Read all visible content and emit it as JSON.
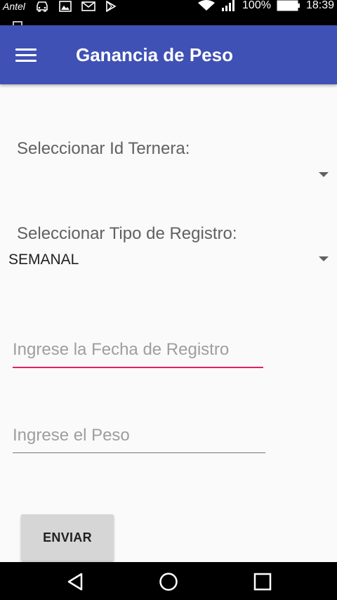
{
  "status_bar": {
    "carrier": "Antel",
    "battery": "100%",
    "time": "18:39",
    "icons": [
      "car-icon",
      "image-icon",
      "mail-icon",
      "play-store-icon",
      "wifi-icon",
      "signal-icon",
      "battery-icon"
    ]
  },
  "toolbar": {
    "title": "Ganancia de Peso",
    "menu_icon": "hamburger-menu-icon",
    "background": "#3f51b5"
  },
  "form": {
    "ternera_label": "Seleccionar Id Ternera:",
    "ternera_value": "",
    "tipo_label": "Seleccionar Tipo de Registro:",
    "tipo_value": "SEMANAL",
    "fecha_placeholder": "Ingrese la Fecha de Registro",
    "peso_placeholder": "Ingrese el Peso",
    "submit_label": "ENVIAR",
    "focus_color": "#e91e63"
  },
  "nav_bar": {
    "icons": [
      "back-icon",
      "home-icon",
      "recents-icon"
    ]
  }
}
